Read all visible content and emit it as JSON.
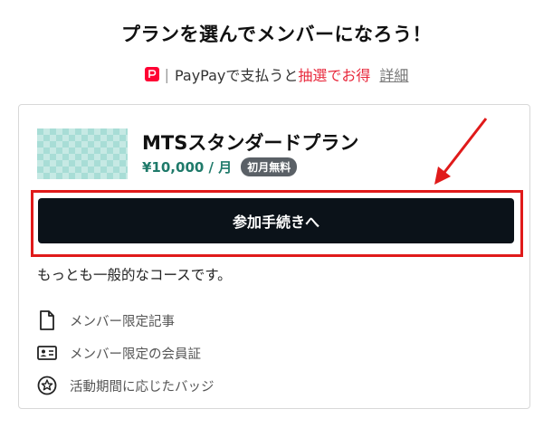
{
  "header": {
    "title": "プランを選んでメンバーになろう！"
  },
  "payment_promo": {
    "separator": "|",
    "text_before": "PayPayで支払うと",
    "highlight": "抽選でお得",
    "detail_link": "詳細",
    "logo_icon": "paypay-icon"
  },
  "plan": {
    "name": "MTSスタンダードプラン",
    "price": "¥10,000 / 月",
    "badge": "初月無料",
    "join_label": "参加手続きへ",
    "description": "もっとも一般的なコースです。",
    "benefits": [
      {
        "icon": "document-icon",
        "label": "メンバー限定記事"
      },
      {
        "icon": "id-card-icon",
        "label": "メンバー限定の会員証"
      },
      {
        "icon": "badge-icon",
        "label": "活動期間に応じたバッジ"
      }
    ]
  },
  "colors": {
    "accent_red": "#e01a1a",
    "button_dark": "#0b1219",
    "price_green": "#1f7a6a",
    "paypay_red": "#ff0033"
  }
}
